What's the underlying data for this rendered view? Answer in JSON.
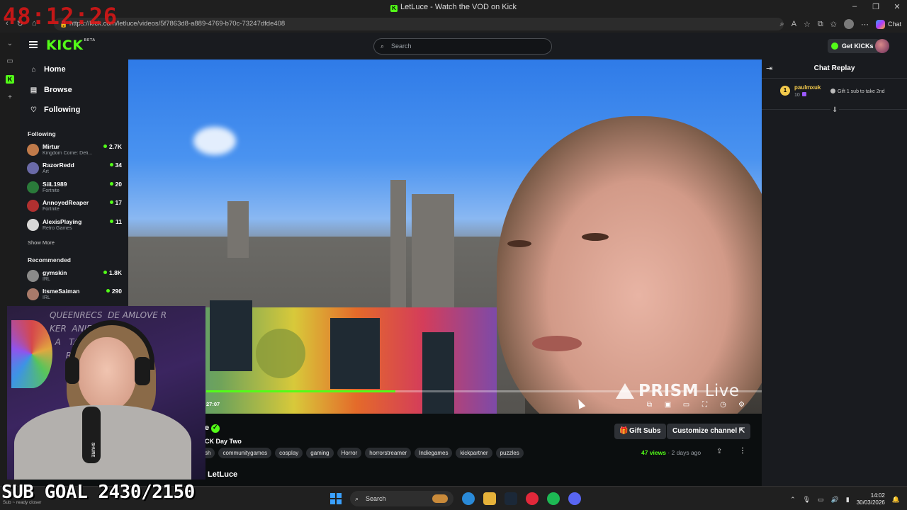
{
  "overlay": {
    "stream_timer": "48:12:26",
    "sub_goal": "SUB GOAL 2430/2150",
    "webcam_text_lines": "QUEENRECS  DE AMLOVE R\nKER  ANIEL  KW\n  A   TALK TO RO\n      RICHARD\n        JOSH\n           KIN",
    "mic_brand": "SHURE"
  },
  "browser": {
    "window_title": "LetLuce - Watch the VOD on Kick",
    "url": "https://kick.com/letluce/videos/5f7863d8-a889-4769-b70c-73247dfde408",
    "copilot_label": "Chat"
  },
  "kick": {
    "logo_text": "KICK",
    "logo_beta": "BETA",
    "search_placeholder": "Search",
    "get_kicks_label": "Get KICKs",
    "nav": {
      "home": "Home",
      "browse": "Browse",
      "following": "Following"
    },
    "following_label": "Following",
    "following_channels": [
      {
        "name": "Mirtur",
        "category": "Kingdom Come: Deli...",
        "viewers": "2.7K",
        "avatar_color": "#c07a4a"
      },
      {
        "name": "RazorRedd",
        "category": "Art",
        "viewers": "34",
        "avatar_color": "#6a6aa8"
      },
      {
        "name": "SiiL1989",
        "category": "Fortnite",
        "viewers": "20",
        "avatar_color": "#2a7a3a"
      },
      {
        "name": "AnnoyedReaper",
        "category": "Fortnite",
        "viewers": "17",
        "avatar_color": "#b03030"
      },
      {
        "name": "AlexisPlaying",
        "category": "Retro Games",
        "viewers": "11",
        "avatar_color": "#d8d8d8"
      }
    ],
    "show_more": "Show More",
    "recommended_label": "Recommended",
    "recommended_channels": [
      {
        "name": "gymskin",
        "category": "IRL",
        "viewers": "1.8K",
        "avatar_color": "#8a8a8a"
      },
      {
        "name": "ItsmeSaiman",
        "category": "IRL",
        "viewers": "290",
        "avatar_color": "#a87a6a"
      }
    ]
  },
  "player": {
    "watermark_bold": "PRISM",
    "watermark_light": "Live",
    "current_time": "27:07",
    "progress_fraction": 0.34
  },
  "vod_info": {
    "name_fragment": "e",
    "title": "CK Day Two",
    "tags": [
      "sh",
      "communitygames",
      "cosplay",
      "gaming",
      "Horror",
      "horrorstreamer",
      "Indiegames",
      "kickpartner",
      "puzzles"
    ],
    "views": "47 views",
    "posted": "2 days ago",
    "gift_subs_label": "Gift Subs",
    "customize_label": "Customize channel",
    "channel_name": "LetLuce"
  },
  "chat": {
    "title": "Chat Replay",
    "message": {
      "username": "paulmxuk",
      "badge": "1",
      "sub_count": "10",
      "text": "Gift 1 sub to take 2nd"
    }
  },
  "taskbar": {
    "search_label": "Search",
    "left_text": "Sub ~ ready closer",
    "time": "14:02",
    "date": "30/03/2026",
    "spotify_color": "#1db954",
    "edge_color": "#2a8ad8"
  },
  "colors": {
    "kick_green": "#53fc18",
    "panel": "#191b1f",
    "timer_red": "#e01616"
  }
}
